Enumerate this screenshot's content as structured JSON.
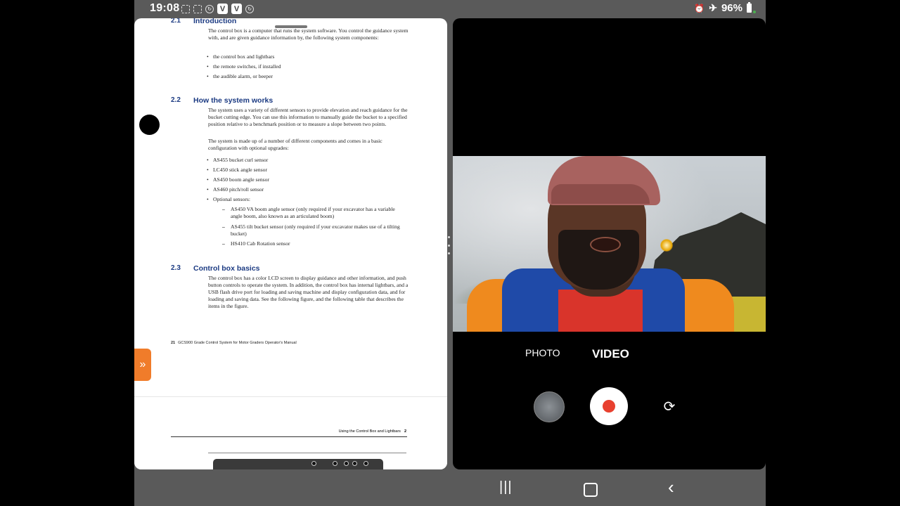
{
  "status_bar": {
    "time": "19:08",
    "left_icons": [
      "screen-record-icon",
      "screenshot-icon",
      "sync-icon",
      "v-app-icon",
      "v-app-icon",
      "sync-icon"
    ],
    "right_icons": [
      "alarm-icon",
      "airplane-mode-icon"
    ],
    "battery": "96%"
  },
  "document": {
    "sections": [
      {
        "number": "2.1",
        "title": "Introduction",
        "paragraphs": [
          "The control box is a computer that runs the system software. You control the guidance system with, and are given guidance information by, the following system components:"
        ],
        "bullets": [
          "the control box and lightbars",
          "the remote switches, if installed",
          "the audible alarm, or beeper"
        ]
      },
      {
        "number": "2.2",
        "title": "How the system works",
        "paragraphs": [
          "The system uses a variety of different sensors to provide elevation and reach guidance for the bucket cutting edge. You can use this information to manually guide the bucket to a specified position relative to a benchmark position or to measure a slope between two points.",
          "The system is made up of a number of different components and comes in a basic configuration with optional upgrades:"
        ],
        "bullets": [
          "AS455 bucket curl sensor",
          "LC450 stick angle sensor",
          "AS450 boom angle sensor",
          "AS460 pitch/roll sensor",
          "Optional sensors:"
        ],
        "sub_bullets": [
          "AS450 VA boom angle sensor (only required if your excavator has a variable angle boom, also known as an articulated boom)",
          "AS455 tilt bucket sensor (only required if your excavator makes use of a tilting bucket)",
          "HS410 Cab Rotation sensor"
        ]
      },
      {
        "number": "2.3",
        "title": "Control box basics",
        "paragraphs": [
          "The control box has a color LCD screen to display guidance and other information, and push button controls to operate the system. In addition, the control box has internal lightbars, and a USB flash drive port for loading and saving machine and display configuration data, and for loading and saving data. See the following figure, and the following table that describes the items in the figure."
        ]
      }
    ],
    "footer": {
      "page": "21",
      "title": "GCS900 Grade Control System for Motor Graders Operator's Manual"
    },
    "next_page_header": {
      "title": "Using the Control Box and Lightbars",
      "page": "2"
    },
    "expand_tab_icon": "double-chevron-right-icon"
  },
  "camera": {
    "modes": [
      "PHOTO",
      "VIDEO"
    ],
    "active_mode": "VIDEO",
    "accent_color": "#e8402f"
  },
  "nav_bar": {
    "buttons": [
      "recent-apps-icon",
      "home-icon",
      "back-icon"
    ]
  }
}
